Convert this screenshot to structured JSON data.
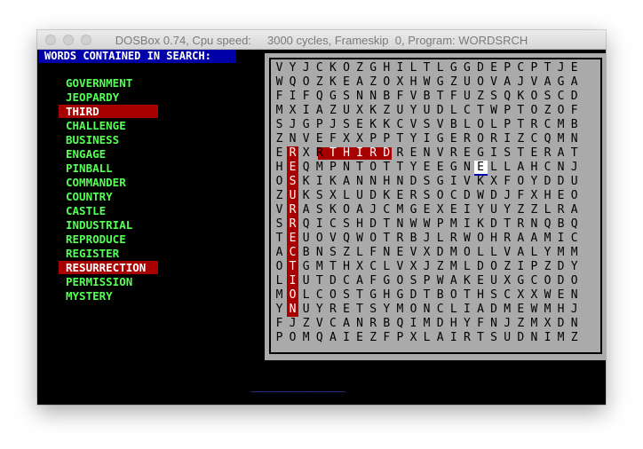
{
  "window": {
    "title": "DOSBox 0.74, Cpu speed:     3000 cycles, Frameskip  0, Program: WORDSRCH"
  },
  "header": {
    "label": "WORDS CONTAINED IN SEARCH:"
  },
  "words": [
    {
      "text": "GOVERNMENT",
      "found": false
    },
    {
      "text": "JEOPARDY",
      "found": false
    },
    {
      "text": "THIRD",
      "found": true
    },
    {
      "text": "CHALLENGE",
      "found": false
    },
    {
      "text": "BUSINESS",
      "found": false
    },
    {
      "text": "ENGAGE",
      "found": false
    },
    {
      "text": "PINBALL",
      "found": false
    },
    {
      "text": "COMMANDER",
      "found": false
    },
    {
      "text": "COUNTRY",
      "found": false
    },
    {
      "text": "CASTLE",
      "found": false
    },
    {
      "text": "INDUSTRIAL",
      "found": false
    },
    {
      "text": "REPRODUCE",
      "found": false
    },
    {
      "text": "REGISTER",
      "found": false
    },
    {
      "text": "RESURRECTION",
      "found": true
    },
    {
      "text": "PERMISSION",
      "found": false
    },
    {
      "text": "MYSTERY",
      "found": false
    }
  ],
  "grid": [
    "VYJCKOZGHILTLGGDEPCPTJE",
    "WQOZKEAZOXHWGZUOVAJVAGA",
    "FIFQGSNNBFVBTFUZSQKOSCD",
    "MXIAZUXKZUYUDLCTWPTOZOF",
    "SJGPJSEKKCVSVBLOLPTRCMB",
    "ZNVEFXXPPTYIGERORIZCQMN",
    "ERXRTHIRDRENVREGISTERAT",
    "HEQMPNTOTTYEEGNELLAHCNJ",
    "OSKIKANNHNDSGIVKXFOYDDU",
    "ZUKSXLUDKERSOCDWDJFXHEO",
    "VRASKOAJCMGEXEIYUYZZLRA",
    "SRQICSHDTNWWPMIKDTRNQBQ",
    "TEUOVQWOTRBJLRWOHRAAMIC",
    "ACBNSZLFNEVXDMOLLVALYMM",
    "OTGMTHXCLVXJZMLDOZIPZDY",
    "LIUTDCAFGOSPWAKEUXGCODO",
    "MOLCOSTGHGDTBOTHSCXXWEN",
    "YNUYRETSYMONCLIADMEWMHJ",
    "FJZVCANRBQIMDHYFNJZMXDN",
    "POMQAIEZFPXLAIRTSUDNIMZ"
  ],
  "input": {
    "value": "_________________"
  }
}
